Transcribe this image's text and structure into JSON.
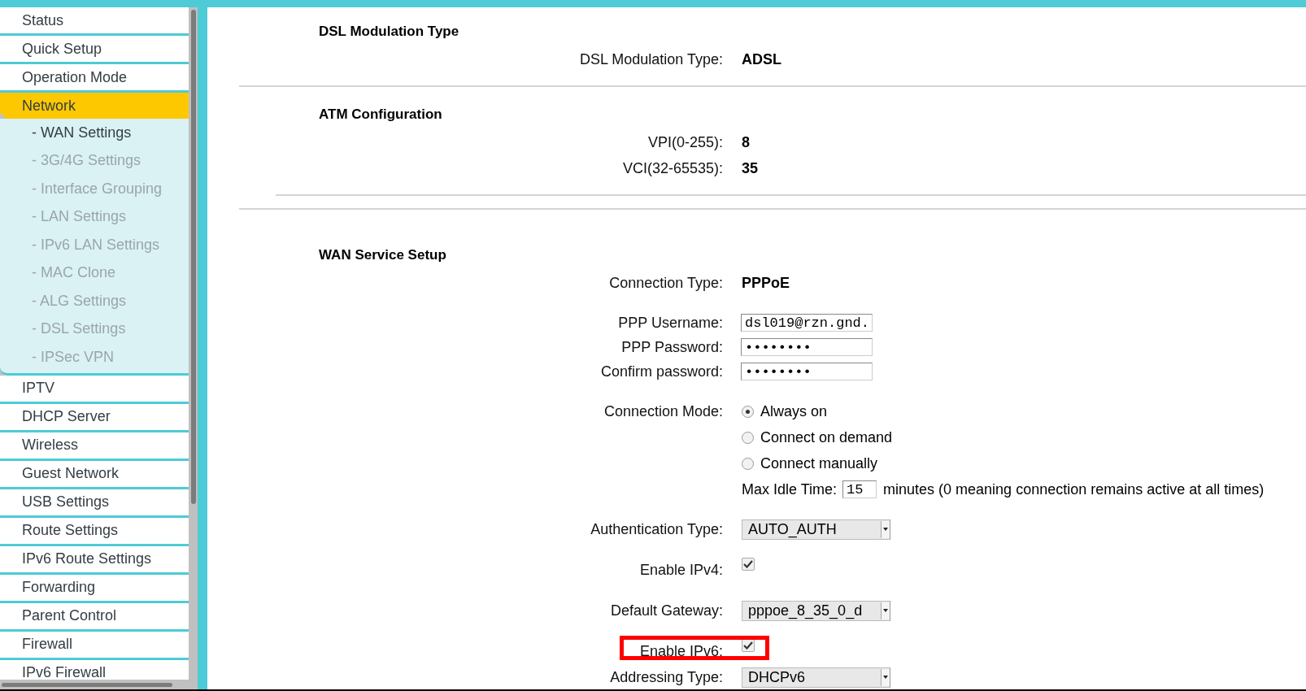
{
  "sidebar": {
    "items": [
      {
        "label": "Status",
        "selected": false
      },
      {
        "label": "Quick Setup",
        "selected": false
      },
      {
        "label": "Operation Mode",
        "selected": false
      },
      {
        "label": "Network",
        "selected": true,
        "children": [
          {
            "label": "- WAN Settings",
            "selected": true
          },
          {
            "label": "- 3G/4G Settings",
            "selected": false
          },
          {
            "label": "- Interface Grouping",
            "selected": false
          },
          {
            "label": "- LAN Settings",
            "selected": false
          },
          {
            "label": "- IPv6 LAN Settings",
            "selected": false
          },
          {
            "label": "- MAC Clone",
            "selected": false
          },
          {
            "label": "- ALG Settings",
            "selected": false
          },
          {
            "label": "- DSL Settings",
            "selected": false
          },
          {
            "label": "- IPSec VPN",
            "selected": false
          }
        ]
      },
      {
        "label": "IPTV",
        "selected": false
      },
      {
        "label": "DHCP Server",
        "selected": false
      },
      {
        "label": "Wireless",
        "selected": false
      },
      {
        "label": "Guest Network",
        "selected": false
      },
      {
        "label": "USB Settings",
        "selected": false
      },
      {
        "label": "Route Settings",
        "selected": false
      },
      {
        "label": "IPv6 Route Settings",
        "selected": false
      },
      {
        "label": "Forwarding",
        "selected": false
      },
      {
        "label": "Parent Control",
        "selected": false
      },
      {
        "label": "Firewall",
        "selected": false
      },
      {
        "label": "IPv6 Firewall",
        "selected": false
      }
    ]
  },
  "sections": [
    {
      "title": "DSL Modulation Type",
      "groups": [
        [
          {
            "kind": "text",
            "label": "DSL Modulation Type:",
            "value": "ADSL"
          }
        ]
      ]
    },
    {
      "title": "ATM Configuration",
      "groups": [
        [
          {
            "kind": "text",
            "label": "VPI(0-255):",
            "value": "8"
          },
          {
            "kind": "text",
            "label": "VCI(32-65535):",
            "value": "35"
          }
        ]
      ]
    },
    {
      "title": "WAN Service Setup",
      "groups": [
        [
          {
            "kind": "text",
            "label": "Connection Type:",
            "value": "PPPoE"
          }
        ],
        [
          {
            "kind": "input",
            "label": "PPP Username:",
            "value": "dsl019@rzn.gnd."
          },
          {
            "kind": "input",
            "label": "PPP Password:",
            "value": "••••••••"
          },
          {
            "kind": "input",
            "label": "Confirm password:",
            "value": "••••••••"
          }
        ],
        [
          {
            "kind": "radio",
            "label": "Connection Mode:",
            "value": "Always on",
            "selected": true
          },
          {
            "kind": "radio",
            "value": "Connect on demand",
            "selected": false
          },
          {
            "kind": "radio",
            "value": "Connect manually",
            "selected": false
          },
          {
            "kind": "idle",
            "value": "Max Idle Time:",
            "input": "15",
            "note": "minutes (0 meaning connection remains active at all times)"
          }
        ],
        [
          {
            "kind": "select",
            "label": "Authentication Type:",
            "value": "AUTO_AUTH"
          }
        ],
        [
          {
            "kind": "checkbox",
            "label": "Enable IPv4:",
            "checked": true,
            "highlighted": false
          }
        ],
        [
          {
            "kind": "select",
            "label": "Default Gateway:",
            "value": "pppoe_8_35_0_d"
          }
        ],
        [
          {
            "kind": "checkbox",
            "label": "Enable IPv6:",
            "checked": true,
            "highlighted": true
          },
          {
            "kind": "select",
            "label": "Addressing Type:",
            "value": "DHCPv6"
          }
        ]
      ]
    }
  ]
}
